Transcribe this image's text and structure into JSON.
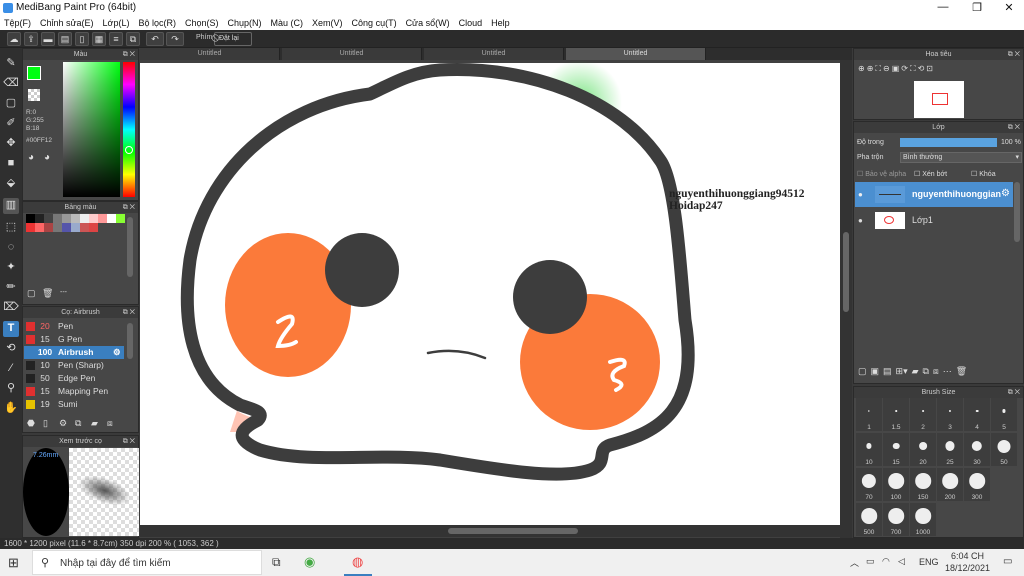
{
  "app": {
    "title": "MediBang Paint Pro (64bit)"
  },
  "menu": [
    "Tệp(F)",
    "Chỉnh sửa(E)",
    "Lớp(L)",
    "Bộ lọc(R)",
    "Chọn(S)",
    "Chụp(N)",
    "Màu (C)",
    "Xem(V)",
    "Công cụ(T)",
    "Cửa sổ(W)",
    "Cloud",
    "Help"
  ],
  "toolbar": {
    "phim_label": "Phím",
    "reset_label": "Đặt lại"
  },
  "tabs": [
    "Untitled",
    "Untitled",
    "Untitled",
    "Untitled"
  ],
  "color_panel": {
    "title": "Màu",
    "r": "R:0",
    "g": "G:255",
    "b": "B:18",
    "hex": "#00FF12"
  },
  "palette_panel": {
    "title": "Bảng màu",
    "dash": "---"
  },
  "brush_panel": {
    "title": "Cọ: Airbrush",
    "items": [
      {
        "size": "20",
        "name": "Pen",
        "color": "#e03030"
      },
      {
        "size": "15",
        "name": "G Pen",
        "color": "#e03030"
      },
      {
        "size": "100",
        "name": "Airbrush",
        "color": "#3a7fc0",
        "selected": true
      },
      {
        "size": "10",
        "name": "Pen (Sharp)",
        "color": "#222222"
      },
      {
        "size": "50",
        "name": "Edge Pen",
        "color": "#222222"
      },
      {
        "size": "15",
        "name": "Mapping Pen",
        "color": "#e03030"
      },
      {
        "size": "19",
        "name": "Sumi",
        "color": "#e6c200"
      }
    ]
  },
  "preview_panel": {
    "title": "Xem trước cọ",
    "size": "7.26mm"
  },
  "navigator": {
    "title": "Hoa tiêu"
  },
  "layer_panel": {
    "title": "Lớp",
    "opacity_label": "Độ trong",
    "opacity_value": "100 %",
    "blend_label": "Pha trộn",
    "blend_value": "Bình thường",
    "protect_alpha": "Bảo vệ alpha",
    "clipping": "Xén bớt",
    "lock": "Khóa",
    "layers": [
      {
        "name": "nguyenthihuonggian",
        "selected": true
      },
      {
        "name": "Lớp1",
        "selected": false
      }
    ]
  },
  "brush_size_panel": {
    "title": "Brush Size",
    "sizes": [
      "1",
      "1.5",
      "2",
      "3",
      "4",
      "5",
      "10",
      "15",
      "20",
      "25",
      "30",
      "50",
      "70",
      "100",
      "150",
      "200",
      "300",
      "500",
      "700",
      "1000"
    ]
  },
  "canvas_text": {
    "line1": "nguyenthihuonggiang94512",
    "line2": "Hoidap247"
  },
  "canvas_colors": {
    "outline": "#3d3d3d",
    "cheek": "#fb7a3a",
    "blush": "#ffc4b4",
    "eye": "#3d3d3d",
    "sprout": "#3fd84a"
  },
  "status": {
    "text": "1600 * 1200 pixel   (11.6 * 8.7cm)   350 dpi   200 %   ( 1053, 362 )"
  },
  "taskbar": {
    "search_placeholder": "Nhập tại đây để tìm kiếm",
    "lang": "ENG",
    "time": "6:04 CH",
    "date": "18/12/2021"
  }
}
